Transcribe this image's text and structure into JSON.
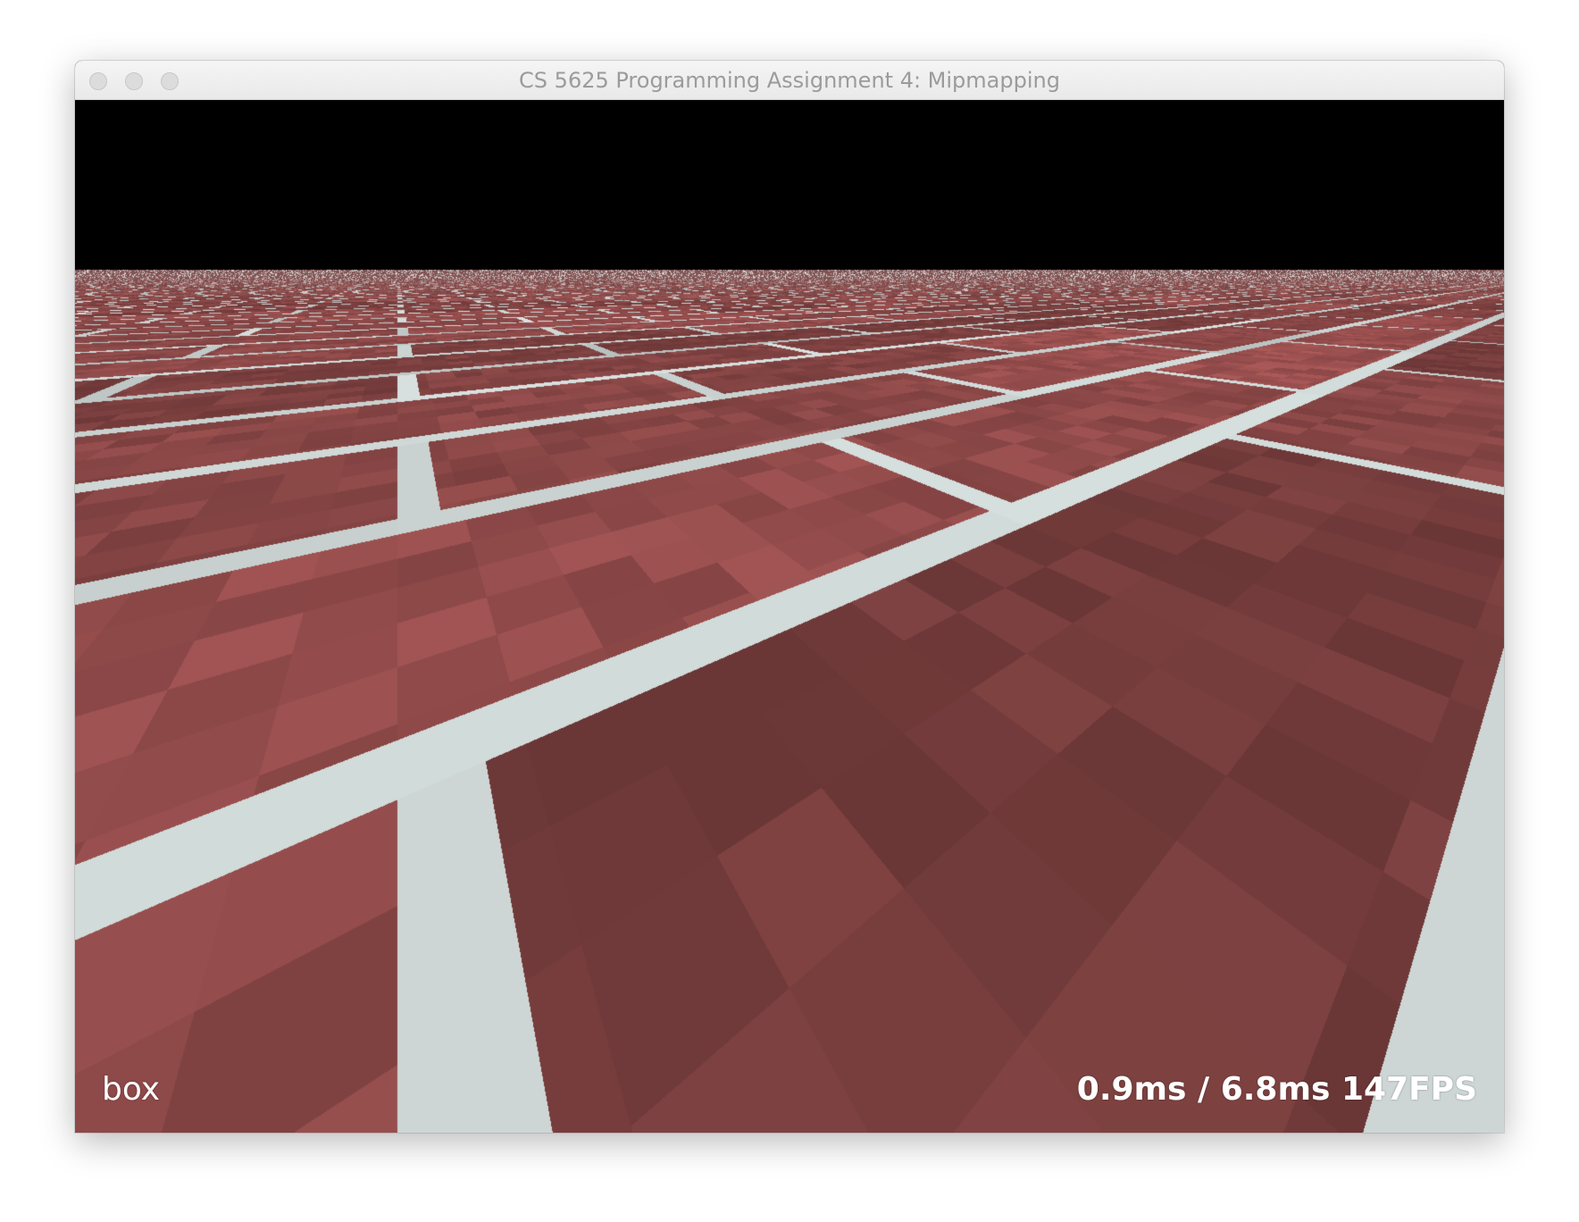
{
  "window": {
    "title": "CS 5625 Programming Assignment 4: Mipmapping"
  },
  "hud": {
    "filter_mode": "box",
    "timing": "0.9ms / 6.8ms 147FPS"
  },
  "scene": {
    "sky_color": "#000000",
    "brick_color": "#8e4a48",
    "mortar_color": "#d9e3e1"
  },
  "icons": {
    "close": "traffic-light-close",
    "minimize": "traffic-light-minimize",
    "zoom": "traffic-light-zoom"
  }
}
